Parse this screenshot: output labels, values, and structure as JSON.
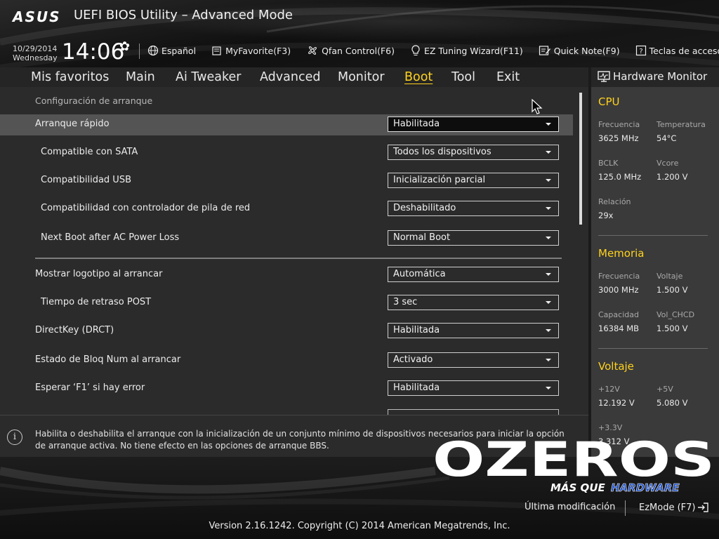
{
  "header": {
    "brand": "ASUS",
    "title": "UEFI BIOS Utility – Advanced Mode",
    "date": "10/29/2014",
    "weekday": "Wednesday",
    "time": "14:06",
    "tools": [
      {
        "label": "Español",
        "icon": "globe-icon"
      },
      {
        "label": "MyFavorite(F3)",
        "icon": "favorite-list-icon"
      },
      {
        "label": "Qfan Control(F6)",
        "icon": "fan-icon"
      },
      {
        "label": "EZ Tuning Wizard(F11)",
        "icon": "lightbulb-icon"
      },
      {
        "label": "Quick Note(F9)",
        "icon": "note-icon"
      },
      {
        "label": "Teclas de acceso directo",
        "icon": "help-key-icon"
      }
    ]
  },
  "tabs": [
    "Mis favoritos",
    "Main",
    "Ai Tweaker",
    "Advanced",
    "Monitor",
    "Boot",
    "Tool",
    "Exit"
  ],
  "active_tab": "Boot",
  "main": {
    "section_title": "Configuración de arranque",
    "settings": [
      {
        "label": "Arranque rápido",
        "value": "Habilitada"
      },
      {
        "label": "Compatible con SATA",
        "value": "Todos los dispositivos"
      },
      {
        "label": "Compatibilidad USB",
        "value": "Inicialización parcial"
      },
      {
        "label": "Compatibilidad con controlador de pila de red",
        "value": "Deshabilitado"
      },
      {
        "label": "Next Boot after AC Power Loss",
        "value": "Normal Boot"
      },
      {
        "label": "Mostrar logotipo al arrancar",
        "value": "Automática"
      },
      {
        "label": "Tiempo de retraso POST",
        "value": "3 sec"
      },
      {
        "label": "DirectKey (DRCT)",
        "value": "Habilitada"
      },
      {
        "label": "Estado de Bloq Num al arrancar",
        "value": "Activado"
      },
      {
        "label": "Esperar ‘F1’ si hay error",
        "value": "Habilitada"
      }
    ]
  },
  "help_text": "Habilita o deshabilita el arranque con la inicialización de un conjunto mínimo de dispositivos necesarios para iniciar la opción de arranque activa. No tiene efecto en las opciones de arranque BBS.",
  "hardware_monitor": {
    "title": "Hardware Monitor",
    "cpu": {
      "heading": "CPU",
      "freq_label": "Frecuencia",
      "freq": "3625 MHz",
      "temp_label": "Temperatura",
      "temp": "54°C",
      "bclk_label": "BCLK",
      "bclk": "125.0 MHz",
      "vcore_label": "Vcore",
      "vcore": "1.200 V",
      "ratio_label": "Relación",
      "ratio": "29x"
    },
    "memory": {
      "heading": "Memoria",
      "freq_label": "Frecuencia",
      "freq": "3000 MHz",
      "volt_label": "Voltaje",
      "volt": "1.500 V",
      "cap_label": "Capacidad",
      "cap": "16384 MB",
      "vchcd_label": "Vol_CHCD",
      "vchcd": "1.500 V"
    },
    "voltage": {
      "heading": "Voltaje",
      "v12_label": "+12V",
      "v12": "12.192 V",
      "v5_label": "+5V",
      "v5": "5.080 V",
      "v33_label": "+3.3V",
      "v33": "3.312 V"
    }
  },
  "footer": {
    "last_modified": "Última modificación",
    "ezmode": "EzMode (F7)",
    "version": "Version 2.16.1242. Copyright (C) 2014 American Megatrends, Inc."
  },
  "watermark": {
    "text": "OZEROS",
    "tagline_1": "MÁS QUE",
    "tagline_2": "HARDWARE"
  },
  "colors": {
    "accent": "#ffd21e",
    "highlight_row": "#545454",
    "panel": "#2b2b2b"
  }
}
